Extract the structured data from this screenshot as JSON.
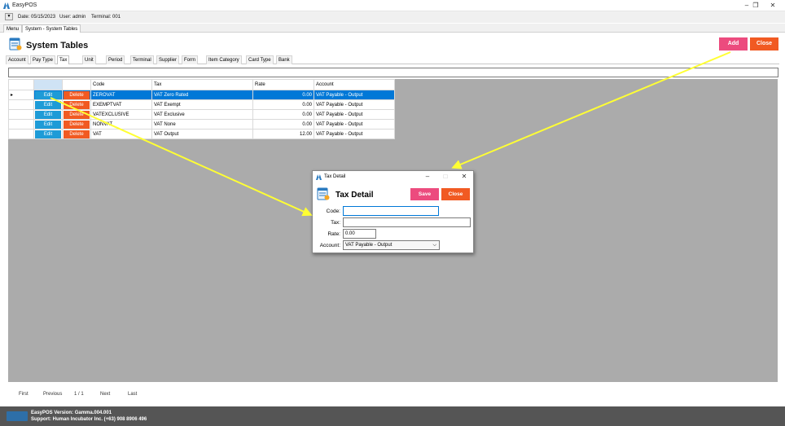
{
  "window": {
    "title": "EasyPOS"
  },
  "info": {
    "date": "Date: 05/15/2023",
    "user": "User: admin",
    "terminal": "Terminal: 001"
  },
  "doc_tabs": [
    {
      "label": "Menu"
    },
    {
      "label": "System - System Tables"
    }
  ],
  "header": {
    "title": "System Tables",
    "add_label": "Add",
    "close_label": "Close"
  },
  "table_tabs": [
    {
      "label": "Account"
    },
    {
      "label": "Pay Type"
    },
    {
      "label": "Tax"
    },
    {
      "label": "Unit"
    },
    {
      "label": "Period"
    },
    {
      "label": "Terminal"
    },
    {
      "label": "Supplier"
    },
    {
      "label": "Form"
    },
    {
      "label": "Item Category"
    },
    {
      "label": "Card Type"
    },
    {
      "label": "Bank"
    }
  ],
  "grid": {
    "columns": {
      "code": "Code",
      "tax": "Tax",
      "rate": "Rate",
      "account": "Account"
    },
    "edit_label": "Edit",
    "delete_label": "Delete",
    "row_marker": "▸",
    "rows": [
      {
        "code": "ZEROVAT",
        "tax": "VAT Zero Rated",
        "rate": "0.00",
        "account": "VAT Payable - Output"
      },
      {
        "code": "EXEMPTVAT",
        "tax": "VAT Exempt",
        "rate": "0.00",
        "account": "VAT Payable - Output"
      },
      {
        "code": "VATEXCLUSIVE",
        "tax": "VAT Exclusive",
        "rate": "0.00",
        "account": "VAT Payable - Output"
      },
      {
        "code": "NONVAT",
        "tax": "VAT None",
        "rate": "0.00",
        "account": "VAT Payable - Output"
      },
      {
        "code": "VAT",
        "tax": "VAT Output",
        "rate": "12.00",
        "account": "VAT Payable - Output"
      }
    ]
  },
  "pager": {
    "first": "First",
    "previous": "Previous",
    "page": "1 / 1",
    "next": "Next",
    "last": "Last"
  },
  "footer": {
    "version": "EasyPOS Version: Gamma.004.001",
    "support": "Support: Human Incubator Inc. (+63) 908 8906 496"
  },
  "dialog": {
    "window_title": "Tax Detail",
    "heading": "Tax Detail",
    "save_label": "Save",
    "close_label": "Close",
    "code_label": "Code:",
    "code_value": "",
    "tax_label": "Tax:",
    "tax_value": "",
    "rate_label": "Rate:",
    "rate_value": "0.00",
    "account_label": "Account:",
    "account_value": "VAT Payable - Output"
  },
  "icons": {
    "app": "easypos-logo-icon",
    "header": "table-document-icon",
    "minimize": "minimize-icon",
    "maximize": "maximize-icon",
    "close": "close-icon"
  },
  "colors": {
    "add": "#ec4b7e",
    "close": "#f15a22",
    "edit": "#1e9bd7",
    "selected": "#0078d7",
    "annotation_arrow": "#ffff33"
  }
}
